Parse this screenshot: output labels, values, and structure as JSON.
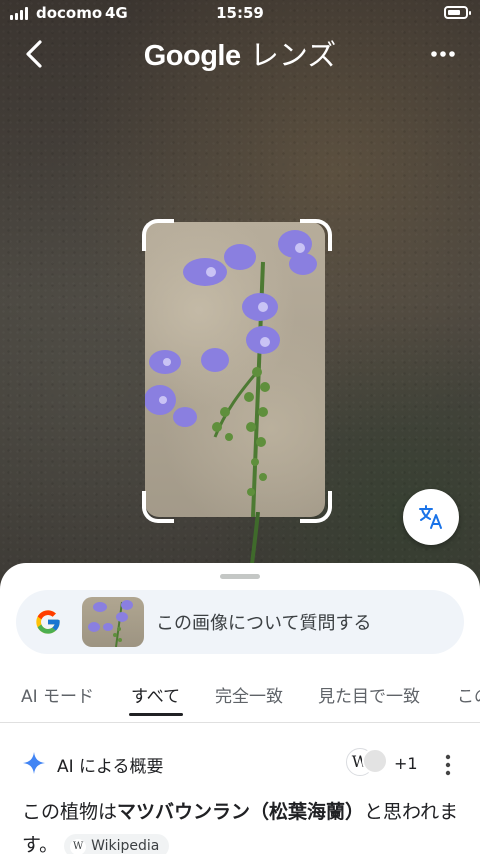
{
  "status_bar": {
    "carrier": "docomo",
    "network": "4G",
    "time": "15:59"
  },
  "header": {
    "title_brand": "Google",
    "title_suffix": " レンズ"
  },
  "search": {
    "prompt": "この画像について質問する"
  },
  "tabs": [
    {
      "label": "AI モード"
    },
    {
      "label": "すべて",
      "active": true
    },
    {
      "label": "完全一致"
    },
    {
      "label": "見た目で一致"
    },
    {
      "label": "この"
    }
  ],
  "ai_overview": {
    "title": "AI による概要",
    "source_more": "+1",
    "sentence_prefix": "この植物は",
    "sentence_bold": "マツバウンラン（松葉海蘭）",
    "sentence_suffix": "と思われます。",
    "source_chip": "Wikipedia",
    "source_chip_icon": "W"
  },
  "colors": {
    "accent_blue": "#1a73e8",
    "sparkle": "#4285f4"
  }
}
